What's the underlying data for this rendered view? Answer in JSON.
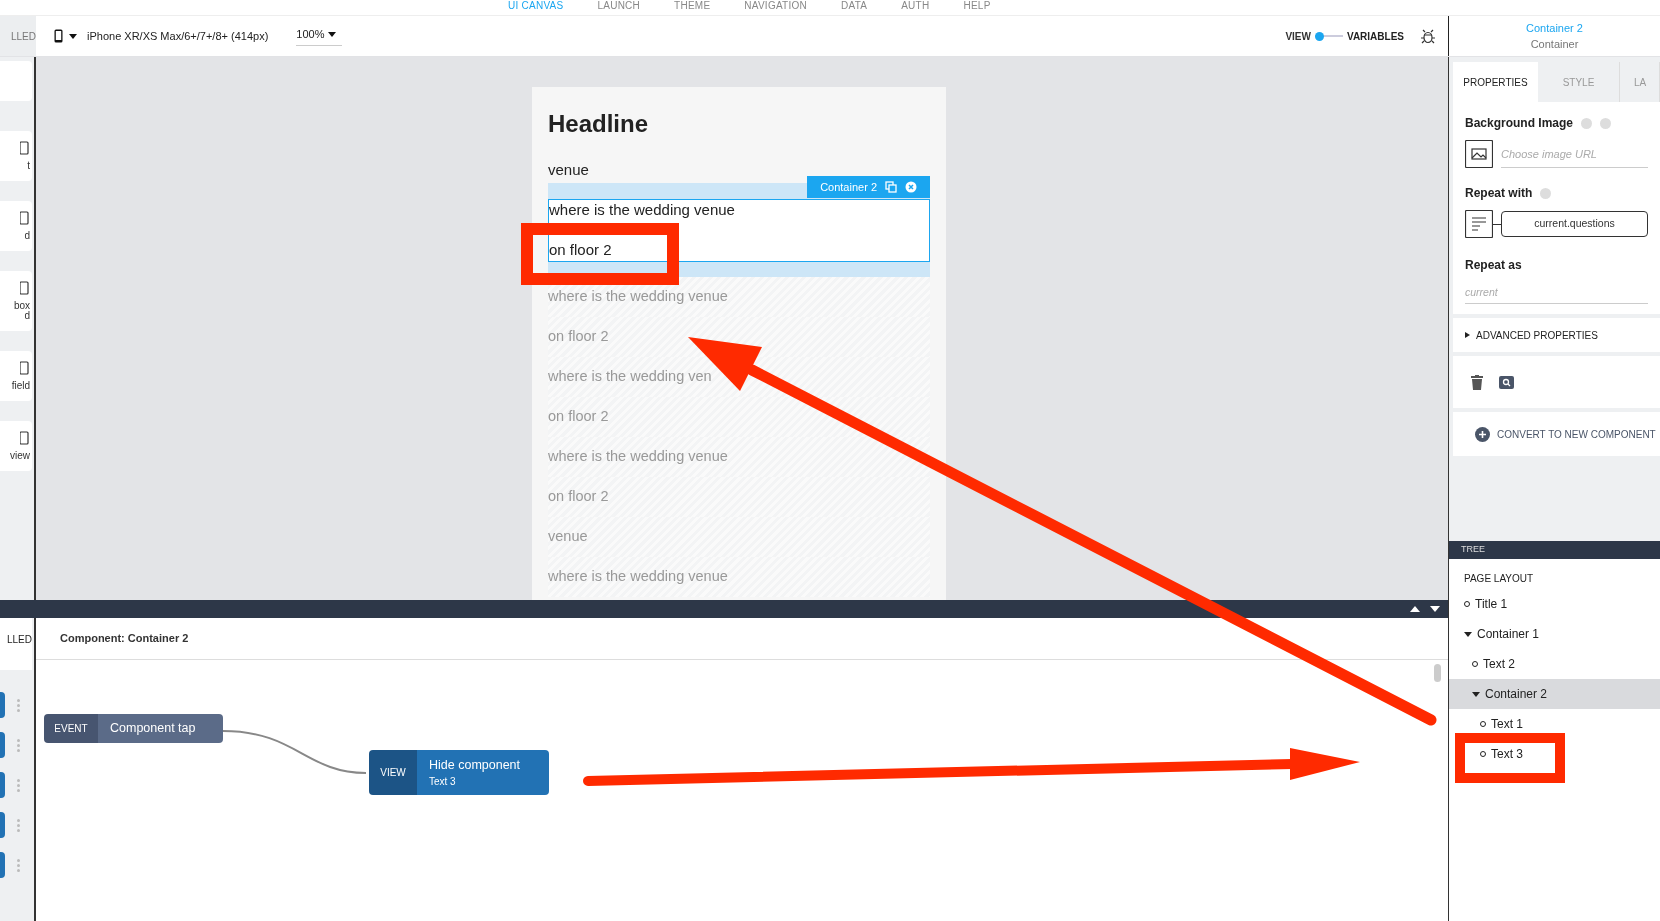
{
  "top_nav": [
    {
      "label": "UI CANVAS",
      "selected": true
    },
    {
      "label": "LAUNCH",
      "selected": false
    },
    {
      "label": "THEME",
      "selected": false
    },
    {
      "label": "NAVIGATION",
      "selected": false
    },
    {
      "label": "DATA",
      "selected": false
    },
    {
      "label": "AUTH",
      "selected": false
    },
    {
      "label": "HELP",
      "selected": false
    }
  ],
  "toolbar": {
    "left_tab": "LLED",
    "device": "iPhone XR/XS Max/6+/7+/8+ (414px)",
    "zoom": "100%",
    "view_label": "VIEW",
    "variables_label": "VARIABLES",
    "view_selected": true
  },
  "selection": {
    "name": "Container 2",
    "type": "Container"
  },
  "palette": [
    {
      "lines": [
        "t"
      ]
    },
    {
      "lines": [
        "d"
      ]
    },
    {
      "lines": [
        "box",
        "d"
      ]
    },
    {
      "lines": [
        "field"
      ]
    },
    {
      "lines": [
        "view"
      ]
    }
  ],
  "phone": {
    "headline": "Headline",
    "label": "venue",
    "container": {
      "label": "Container 2",
      "rows": [
        "where is the wedding venue",
        "on floor 2"
      ]
    },
    "rows": [
      "where is the wedding venue",
      "on floor 2",
      "where is the wedding ven",
      "on floor 2",
      "where is the wedding venue",
      "on floor 2",
      "venue",
      "where is the wedding venue"
    ]
  },
  "properties": {
    "tabs": [
      {
        "label": "PROPERTIES",
        "selected": true
      },
      {
        "label": "STYLE",
        "selected": false
      },
      {
        "label": "LA",
        "selected": false
      }
    ],
    "background_image": {
      "label": "Background Image",
      "placeholder": "Choose image URL"
    },
    "repeat_with": {
      "label": "Repeat with",
      "value": "current.questions"
    },
    "repeat_as": {
      "label": "Repeat as",
      "placeholder": "current"
    },
    "advanced": {
      "label": "ADVANCED PROPERTIES",
      "expanded": false
    },
    "convert": "CONVERT TO NEW COMPONENT"
  },
  "tree": {
    "title": "TREE",
    "section": "PAGE LAYOUT",
    "items": [
      {
        "label": "Title 1",
        "selected": false
      },
      {
        "label": "Container 1",
        "selected": false,
        "expanded": true,
        "children": [
          {
            "label": "Text 2",
            "selected": false
          },
          {
            "label": "Container 2",
            "selected": true,
            "expanded": true,
            "children": [
              {
                "label": "Text 1",
                "selected": false
              },
              {
                "label": "Text 3",
                "selected": false
              }
            ]
          }
        ]
      }
    ]
  },
  "logic": {
    "left_tab": "LLED",
    "title": "Component: Container 2",
    "nodes": [
      {
        "kind": "event",
        "tag": "EVENT",
        "label": "Component tap"
      },
      {
        "kind": "action",
        "tag": "VIEW",
        "label": "Hide component",
        "sub": "Text 3"
      }
    ]
  }
}
